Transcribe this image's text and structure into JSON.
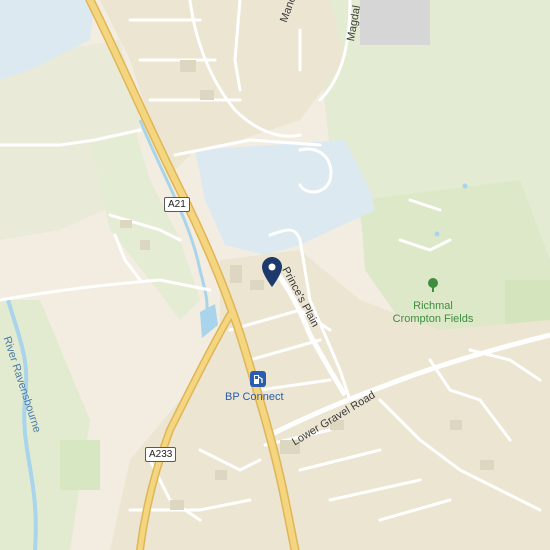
{
  "colors": {
    "background": "#f2ede0",
    "park": "#e3ecd2",
    "water": "#a9d4ec",
    "major_road": "#f5d680",
    "major_road_casing": "#e0b556",
    "minor_road": "#ffffff",
    "building_area": "#e9e2cf",
    "institution": "#dde9f1",
    "pin": "#1c3a6b"
  },
  "road_shields": {
    "a21": "A21",
    "a233": "A233"
  },
  "street_labels": {
    "manor": "Manor W",
    "magdalen": "Magdal",
    "princes_plain": "Prince's Plain",
    "lower_gravel_road": "Lower Gravel Road"
  },
  "water_labels": {
    "river": "River Ravensbourne"
  },
  "poi": {
    "park_line1": "Richmal",
    "park_line2": "Crompton Fields",
    "park_icon": "tree-icon",
    "fuel_name": "BP Connect",
    "fuel_icon": "fuel-pump-icon",
    "pin_icon": "location-pin-icon"
  }
}
